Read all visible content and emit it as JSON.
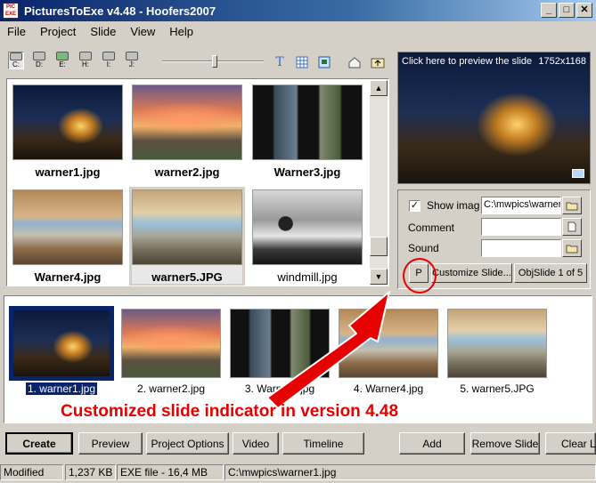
{
  "window": {
    "title": "PicturesToExe v4.48 - Hoofers2007",
    "icon_text_top": "PIC",
    "icon_text_bottom": "EXE",
    "minimize": "_",
    "maximize": "□",
    "close": "✕"
  },
  "menu": [
    "File",
    "Project",
    "Slide",
    "View",
    "Help"
  ],
  "toolbar": {
    "drives": [
      "C:",
      "D:",
      "E:",
      "H:",
      "I:",
      "J:"
    ],
    "selected_drive": "C:",
    "text_icon": "T"
  },
  "browser": {
    "thumbnails": [
      {
        "label": "warner1.jpg"
      },
      {
        "label": "warner2.jpg"
      },
      {
        "label": "Warner3.jpg"
      },
      {
        "label": "Warner4.jpg"
      },
      {
        "label": "warner5.JPG"
      },
      {
        "label": "windmill.jpg"
      }
    ],
    "scroll_up": "▲",
    "scroll_down": "▼"
  },
  "preview": {
    "hint": "Click here to preview the slide",
    "resolution": "1752x1168"
  },
  "slide_props": {
    "show_image_checked": "✓",
    "show_image_label": "Show imag",
    "image_path": "C:\\mwpics\\warner",
    "comment_label": "Comment",
    "sound_label": "Sound",
    "comment_value": "",
    "sound_value": "",
    "p_label": "P",
    "customize_label": "Customize Slide...",
    "objslide_label": "ObjSlide 1 of 5"
  },
  "slides": [
    {
      "label": "1. warner1.jpg"
    },
    {
      "label": "2. warner2.jpg"
    },
    {
      "label": "3. Warner3.jpg"
    },
    {
      "label": "4. Warner4.jpg"
    },
    {
      "label": "5. warner5.JPG"
    }
  ],
  "buttons": {
    "create": "Create",
    "preview": "Preview",
    "project_options": "Project Options",
    "video": "Video",
    "timeline": "Timeline",
    "add": "Add",
    "remove_slide": "Remove Slide",
    "clear_list": "Clear List"
  },
  "statusbar": {
    "state": "Modified",
    "size": "1,237 KB",
    "exe": "EXE file - 16,4 MB",
    "path": "C:\\mwpics\\warner1.jpg"
  },
  "annotation": {
    "text": "Customized slide indicator in version 4.48"
  },
  "colors": {
    "accent_red": "#e60000",
    "selection_blue": "#0a246a"
  }
}
